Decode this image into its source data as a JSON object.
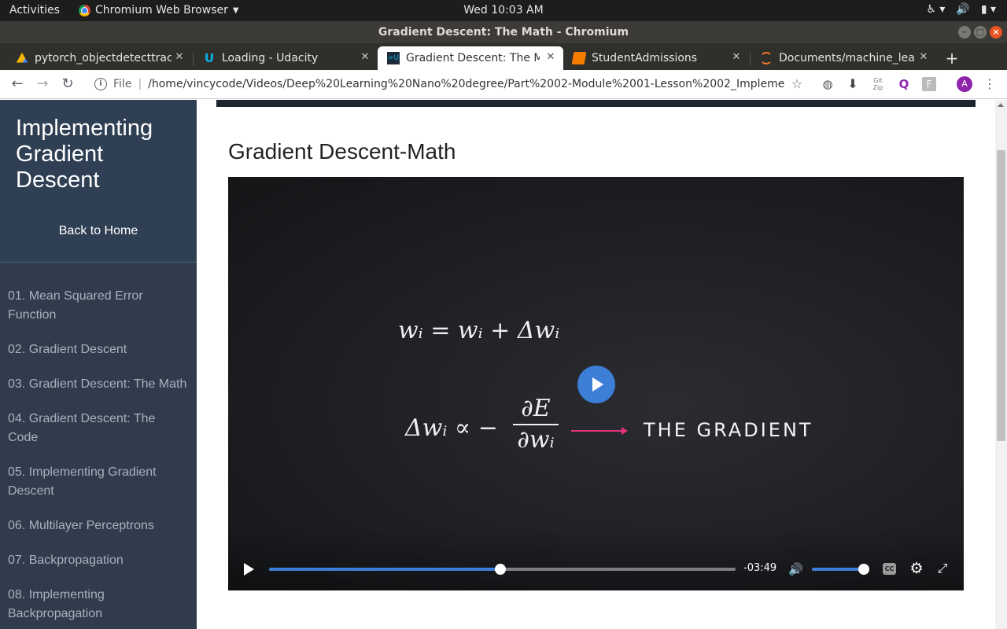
{
  "system_bar": {
    "activities": "Activities",
    "app_menu": "Chromium Web Browser",
    "clock": "Wed 10:03 AM",
    "tray_icons": [
      "accessibility-icon",
      "volume-icon",
      "battery-icon"
    ]
  },
  "window": {
    "title": "Gradient Descent: The Math - Chromium"
  },
  "tabs": [
    {
      "title": "pytorch_objectdetecttrac",
      "icon": "google-drive-icon",
      "active": false
    },
    {
      "title": "Loading - Udacity",
      "icon": "udacity-icon",
      "active": false
    },
    {
      "title": "Gradient Descent: The Ma",
      "icon": "udacity-terminal-icon",
      "active": true
    },
    {
      "title": "StudentAdmissions",
      "icon": "notebook-icon",
      "active": false
    },
    {
      "title": "Documents/machine_lea",
      "icon": "jupyter-icon",
      "active": false
    }
  ],
  "address_bar": {
    "scheme": "File",
    "url": "/home/vincycode/Videos/Deep%20Learning%20Nano%20degree/Part%2002-Module%2001-Lesson%2002_Implementing%2...",
    "avatar_letter": "A"
  },
  "sidebar": {
    "lesson_title": "Implementing Gradient Descent",
    "back_home": "Back to Home",
    "concepts": [
      "01. Mean Squared Error Function",
      "02. Gradient Descent",
      "03. Gradient Descent: The Math",
      "04. Gradient Descent: The Code",
      "05. Implementing Gradient Descent",
      "06. Multilayer Perceptrons",
      "07. Backpropagation",
      "08. Implementing Backpropagation"
    ]
  },
  "main": {
    "concept_title": "Gradient Descent-Math"
  },
  "video": {
    "equation_1": "wᵢ = wᵢ + Δwᵢ",
    "equation_2_lhs": "Δwᵢ ∝ −",
    "frac_num": "∂E",
    "frac_den": "∂wᵢ",
    "gradient_label": "THE GRADIENT",
    "time_remaining": "-03:49",
    "progress_fraction": 0.495,
    "volume_fraction": 1.0,
    "cc_label": "CC",
    "accent_color": "#3d7fd6",
    "arrow_color": "#e8317a"
  }
}
